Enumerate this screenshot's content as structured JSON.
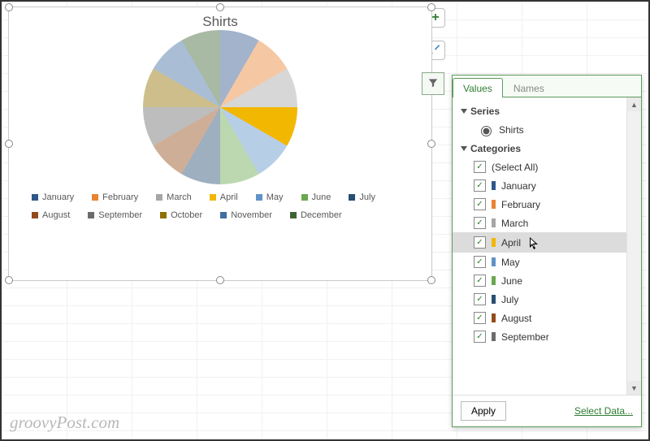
{
  "chart_data": {
    "type": "pie",
    "title": "Shirts",
    "categories": [
      "January",
      "February",
      "March",
      "April",
      "May",
      "June",
      "July",
      "August",
      "September",
      "October",
      "November",
      "December"
    ],
    "values": [
      8.3,
      8.3,
      8.3,
      8.3,
      8.3,
      8.3,
      8.3,
      8.3,
      8.3,
      8.3,
      8.3,
      8.3
    ],
    "colors": [
      "#30578b",
      "#e88433",
      "#a6a6a6",
      "#f2b701",
      "#6093c9",
      "#6aa84f",
      "#274e73",
      "#944b1a",
      "#6c6c6c",
      "#8f6e00",
      "#3f6ea1",
      "#3e6435"
    ],
    "legend_position": "bottom"
  },
  "filter": {
    "tabs": {
      "values": "Values",
      "names": "Names"
    },
    "series_label": "Series",
    "series_option": "Shirts",
    "categories_label": "Categories",
    "select_all": "(Select All)",
    "months": [
      "January",
      "February",
      "March",
      "April",
      "May",
      "June",
      "July",
      "August",
      "September"
    ],
    "month_colors": [
      "#30578b",
      "#e88433",
      "#a6a6a6",
      "#f2b701",
      "#6093c9",
      "#6aa84f",
      "#274e73",
      "#944b1a",
      "#6c6c6c"
    ],
    "highlighted": "April",
    "apply": "Apply",
    "select_data": "Select Data..."
  },
  "watermark": "groovyPost.com"
}
